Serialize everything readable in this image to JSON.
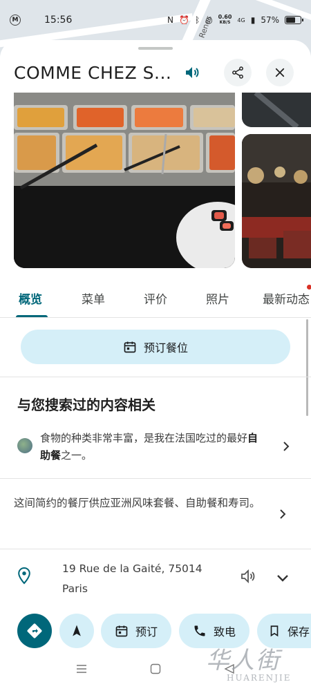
{
  "status_bar": {
    "time": "15:56",
    "left_icon": "M",
    "net_speed_value": "0.60",
    "net_speed_unit": "KB/S",
    "network": "4G",
    "battery": "57%"
  },
  "map": {
    "road_label": "e Renes"
  },
  "header": {
    "title": "COMME CHEZ S...",
    "speaker_icon": "volume-icon",
    "share_icon": "share-icon",
    "close_icon": "close-icon"
  },
  "tabs": [
    {
      "label": "概览",
      "active": true
    },
    {
      "label": "菜单",
      "active": false
    },
    {
      "label": "评价",
      "active": false
    },
    {
      "label": "照片",
      "active": false
    },
    {
      "label": "最新动态",
      "active": false
    }
  ],
  "reserve_button": {
    "label": "预订餐位",
    "icon": "calendar-icon"
  },
  "related": {
    "title": "与您搜索过的内容相关",
    "review_text_pre": "食物的种类非常丰富，是我在法国吃过的最好",
    "review_text_bold": "自助餐",
    "review_text_post": "之一。"
  },
  "description": "这间简约的餐厅供应亚洲风味套餐、自助餐和寿司。",
  "address": {
    "line1": "19 Rue de la Gaité, 75014",
    "line2": "Paris"
  },
  "actions": [
    {
      "label": "",
      "icon": "directions-icon"
    },
    {
      "label": "",
      "icon": "navigation-arrow-icon"
    },
    {
      "label": "预订",
      "icon": "calendar-icon"
    },
    {
      "label": "致电",
      "icon": "phone-icon"
    },
    {
      "label": "保存",
      "icon": "bookmark-icon"
    }
  ],
  "colors": {
    "accent": "#00677a",
    "tonal_button": "#d5eff8",
    "notification_dot": "#d93025"
  },
  "watermark": {
    "big": "华人街",
    "small": "HUARENJIE"
  }
}
